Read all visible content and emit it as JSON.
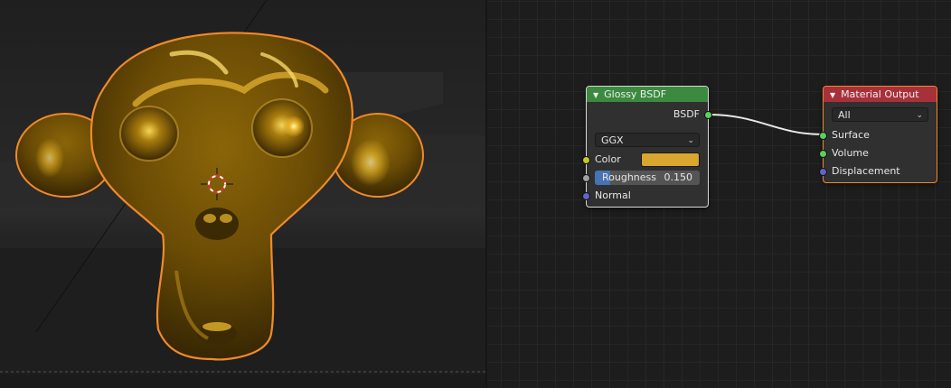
{
  "viewport": {
    "object_outline_color": "#f08a2a",
    "material_color": "#d9a62f"
  },
  "nodes": {
    "glossy": {
      "title": "Glossy BSDF",
      "header_color": "#3b8a3f",
      "output_label": "BSDF",
      "distribution": "GGX",
      "color_label": "Color",
      "color_value": "#d9a62f",
      "roughness_label": "Roughness",
      "roughness_value": "0.150",
      "roughness_fraction": 0.15,
      "normal_label": "Normal"
    },
    "output": {
      "title": "Material Output",
      "header_color": "#a8303a",
      "target": "All",
      "surface_label": "Surface",
      "volume_label": "Volume",
      "displacement_label": "Displacement"
    }
  },
  "sockets": {
    "shader_color": "#5ccf5c",
    "color_color": "#c7c729",
    "float_color": "#a1a1a1",
    "vector_color": "#6363c7"
  },
  "link_color": "#e8e8e8"
}
